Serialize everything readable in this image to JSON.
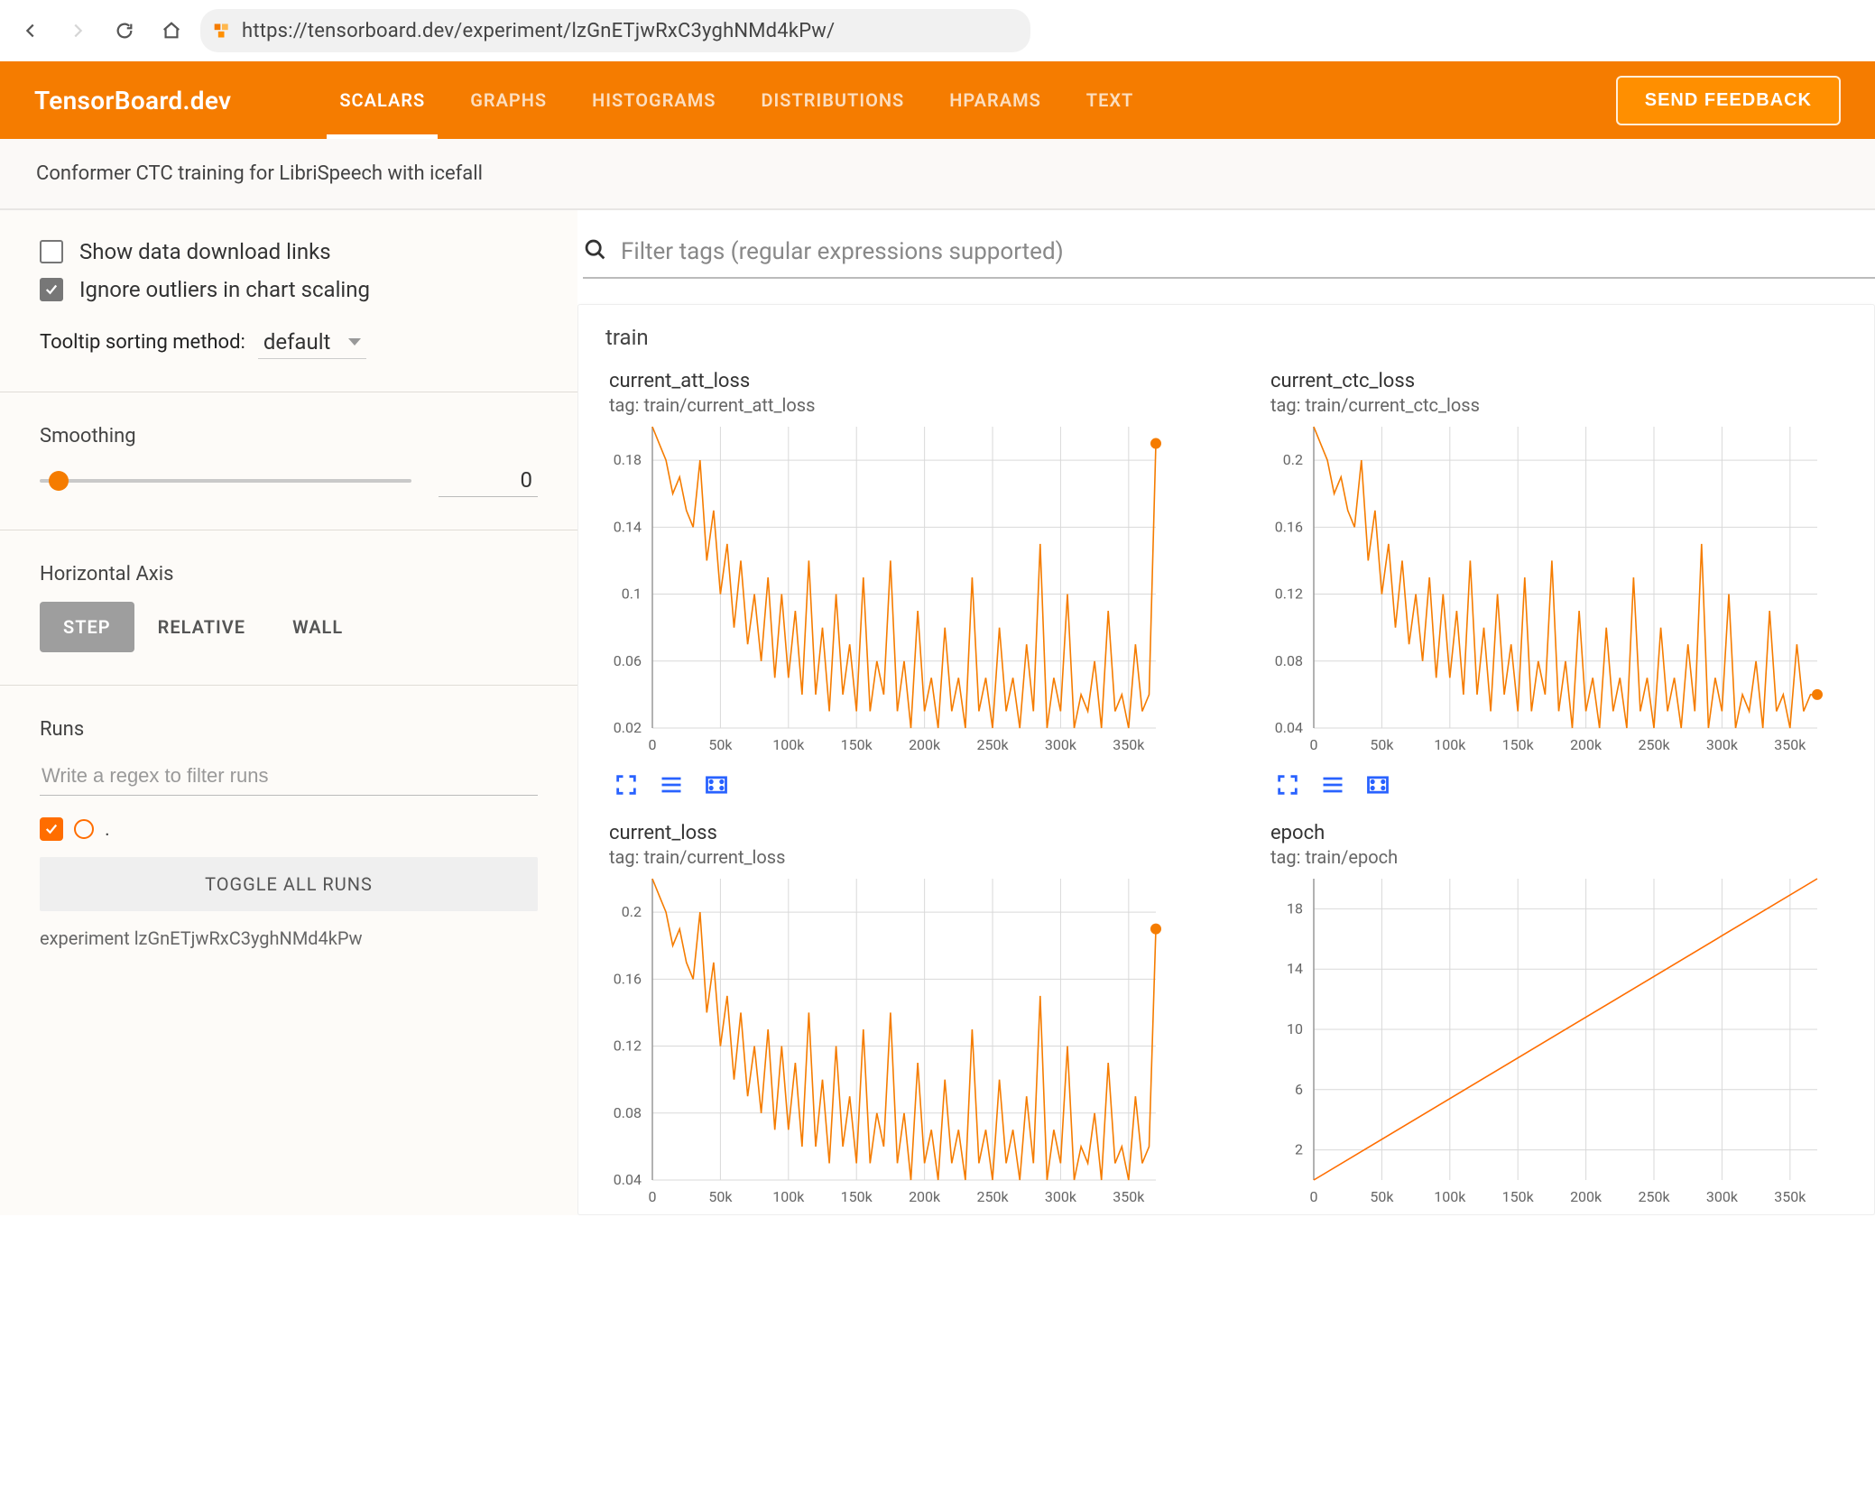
{
  "browser": {
    "url": "https://tensorboard.dev/experiment/lzGnETjwRxC3yghNMd4kPw/"
  },
  "header": {
    "logo": "TensorBoard.dev",
    "tabs": [
      "SCALARS",
      "GRAPHS",
      "HISTOGRAMS",
      "DISTRIBUTIONS",
      "HPARAMS",
      "TEXT"
    ],
    "active_tab": "SCALARS",
    "feedback_label": "SEND FEEDBACK"
  },
  "subheader": "Conformer CTC training for LibriSpeech with icefall",
  "sidebar": {
    "show_download_links": {
      "label": "Show data download links",
      "checked": false
    },
    "ignore_outliers": {
      "label": "Ignore outliers in chart scaling",
      "checked": true
    },
    "tooltip_sort": {
      "label": "Tooltip sorting method:",
      "value": "default"
    },
    "smoothing": {
      "label": "Smoothing",
      "value": "0",
      "position_pct": 5
    },
    "horizontal_axis": {
      "label": "Horizontal Axis",
      "options": [
        "STEP",
        "RELATIVE",
        "WALL"
      ],
      "active": "STEP"
    },
    "runs": {
      "label": "Runs",
      "filter_placeholder": "Write a regex to filter runs",
      "toggle_all_label": "TOGGLE ALL RUNS",
      "run_name": "."
    },
    "experiment_line": "experiment lzGnETjwRxC3yghNMd4kPw"
  },
  "content": {
    "filter_placeholder": "Filter tags (regular expressions supported)",
    "group_title": "train"
  },
  "chart_data": [
    {
      "id": "current_att_loss",
      "title": "current_att_loss",
      "tag": "tag: train/current_att_loss",
      "type": "line",
      "xlabel": "",
      "ylabel": "",
      "xlim": [
        0,
        370000
      ],
      "ylim": [
        0.02,
        0.2
      ],
      "x_ticks": [
        0,
        50000,
        100000,
        150000,
        200000,
        250000,
        300000,
        350000
      ],
      "x_tick_labels": [
        "0",
        "50k",
        "100k",
        "150k",
        "200k",
        "250k",
        "300k",
        "350k"
      ],
      "y_ticks": [
        0.02,
        0.06,
        0.1,
        0.14,
        0.18
      ],
      "series": [
        {
          "name": ".",
          "color": "#f57c00",
          "x": [
            0,
            5000,
            10000,
            15000,
            20000,
            25000,
            30000,
            35000,
            40000,
            45000,
            50000,
            55000,
            60000,
            65000,
            70000,
            75000,
            80000,
            85000,
            90000,
            95000,
            100000,
            105000,
            110000,
            115000,
            120000,
            125000,
            130000,
            135000,
            140000,
            145000,
            150000,
            155000,
            160000,
            165000,
            170000,
            175000,
            180000,
            185000,
            190000,
            195000,
            200000,
            205000,
            210000,
            215000,
            220000,
            225000,
            230000,
            235000,
            240000,
            245000,
            250000,
            255000,
            260000,
            265000,
            270000,
            275000,
            280000,
            285000,
            290000,
            295000,
            300000,
            305000,
            310000,
            315000,
            320000,
            325000,
            330000,
            335000,
            340000,
            345000,
            350000,
            355000,
            360000,
            365000,
            370000
          ],
          "values": [
            0.2,
            0.19,
            0.18,
            0.16,
            0.17,
            0.15,
            0.14,
            0.18,
            0.12,
            0.15,
            0.1,
            0.13,
            0.08,
            0.12,
            0.07,
            0.1,
            0.06,
            0.11,
            0.05,
            0.1,
            0.05,
            0.09,
            0.04,
            0.12,
            0.04,
            0.08,
            0.03,
            0.1,
            0.04,
            0.07,
            0.03,
            0.11,
            0.03,
            0.06,
            0.04,
            0.12,
            0.03,
            0.06,
            0.02,
            0.09,
            0.03,
            0.05,
            0.02,
            0.08,
            0.03,
            0.05,
            0.02,
            0.11,
            0.03,
            0.05,
            0.02,
            0.08,
            0.03,
            0.05,
            0.02,
            0.07,
            0.03,
            0.13,
            0.02,
            0.05,
            0.03,
            0.1,
            0.02,
            0.04,
            0.03,
            0.06,
            0.02,
            0.09,
            0.03,
            0.04,
            0.02,
            0.07,
            0.03,
            0.04,
            0.19
          ]
        }
      ],
      "end_marker": true
    },
    {
      "id": "current_ctc_loss",
      "title": "current_ctc_loss",
      "tag": "tag: train/current_ctc_loss",
      "type": "line",
      "xlabel": "",
      "ylabel": "",
      "xlim": [
        0,
        370000
      ],
      "ylim": [
        0.04,
        0.22
      ],
      "x_ticks": [
        0,
        50000,
        100000,
        150000,
        200000,
        250000,
        300000,
        350000
      ],
      "x_tick_labels": [
        "0",
        "50k",
        "100k",
        "150k",
        "200k",
        "250k",
        "300k",
        "350k"
      ],
      "y_ticks": [
        0.04,
        0.08,
        0.12,
        0.16,
        0.2
      ],
      "series": [
        {
          "name": ".",
          "color": "#f57c00",
          "x": [
            0,
            5000,
            10000,
            15000,
            20000,
            25000,
            30000,
            35000,
            40000,
            45000,
            50000,
            55000,
            60000,
            65000,
            70000,
            75000,
            80000,
            85000,
            90000,
            95000,
            100000,
            105000,
            110000,
            115000,
            120000,
            125000,
            130000,
            135000,
            140000,
            145000,
            150000,
            155000,
            160000,
            165000,
            170000,
            175000,
            180000,
            185000,
            190000,
            195000,
            200000,
            205000,
            210000,
            215000,
            220000,
            225000,
            230000,
            235000,
            240000,
            245000,
            250000,
            255000,
            260000,
            265000,
            270000,
            275000,
            280000,
            285000,
            290000,
            295000,
            300000,
            305000,
            310000,
            315000,
            320000,
            325000,
            330000,
            335000,
            340000,
            345000,
            350000,
            355000,
            360000,
            365000,
            370000
          ],
          "values": [
            0.22,
            0.21,
            0.2,
            0.18,
            0.19,
            0.17,
            0.16,
            0.2,
            0.14,
            0.17,
            0.12,
            0.15,
            0.1,
            0.14,
            0.09,
            0.12,
            0.08,
            0.13,
            0.07,
            0.12,
            0.07,
            0.11,
            0.06,
            0.14,
            0.06,
            0.1,
            0.05,
            0.12,
            0.06,
            0.09,
            0.05,
            0.13,
            0.05,
            0.08,
            0.06,
            0.14,
            0.05,
            0.08,
            0.04,
            0.11,
            0.05,
            0.07,
            0.04,
            0.1,
            0.05,
            0.07,
            0.04,
            0.13,
            0.05,
            0.07,
            0.04,
            0.1,
            0.05,
            0.07,
            0.04,
            0.09,
            0.05,
            0.15,
            0.04,
            0.07,
            0.05,
            0.12,
            0.04,
            0.06,
            0.05,
            0.08,
            0.04,
            0.11,
            0.05,
            0.06,
            0.04,
            0.09,
            0.05,
            0.06,
            0.06
          ]
        }
      ],
      "end_marker": true
    },
    {
      "id": "current_loss",
      "title": "current_loss",
      "tag": "tag: train/current_loss",
      "type": "line",
      "xlabel": "",
      "ylabel": "",
      "xlim": [
        0,
        370000
      ],
      "ylim": [
        0.04,
        0.22
      ],
      "x_ticks": [
        0,
        50000,
        100000,
        150000,
        200000,
        250000,
        300000,
        350000
      ],
      "x_tick_labels": [
        "0",
        "50k",
        "100k",
        "150k",
        "200k",
        "250k",
        "300k",
        "350k"
      ],
      "y_ticks": [
        0.04,
        0.08,
        0.12,
        0.16,
        0.2
      ],
      "series": [
        {
          "name": ".",
          "color": "#f57c00",
          "x": [
            0,
            5000,
            10000,
            15000,
            20000,
            25000,
            30000,
            35000,
            40000,
            45000,
            50000,
            55000,
            60000,
            65000,
            70000,
            75000,
            80000,
            85000,
            90000,
            95000,
            100000,
            105000,
            110000,
            115000,
            120000,
            125000,
            130000,
            135000,
            140000,
            145000,
            150000,
            155000,
            160000,
            165000,
            170000,
            175000,
            180000,
            185000,
            190000,
            195000,
            200000,
            205000,
            210000,
            215000,
            220000,
            225000,
            230000,
            235000,
            240000,
            245000,
            250000,
            255000,
            260000,
            265000,
            270000,
            275000,
            280000,
            285000,
            290000,
            295000,
            300000,
            305000,
            310000,
            315000,
            320000,
            325000,
            330000,
            335000,
            340000,
            345000,
            350000,
            355000,
            360000,
            365000,
            370000
          ],
          "values": [
            0.22,
            0.21,
            0.2,
            0.18,
            0.19,
            0.17,
            0.16,
            0.2,
            0.14,
            0.17,
            0.12,
            0.15,
            0.1,
            0.14,
            0.09,
            0.12,
            0.08,
            0.13,
            0.07,
            0.12,
            0.07,
            0.11,
            0.06,
            0.14,
            0.06,
            0.1,
            0.05,
            0.12,
            0.06,
            0.09,
            0.05,
            0.13,
            0.05,
            0.08,
            0.06,
            0.14,
            0.05,
            0.08,
            0.04,
            0.11,
            0.05,
            0.07,
            0.04,
            0.1,
            0.05,
            0.07,
            0.04,
            0.13,
            0.05,
            0.07,
            0.04,
            0.1,
            0.05,
            0.07,
            0.04,
            0.09,
            0.05,
            0.15,
            0.04,
            0.07,
            0.05,
            0.12,
            0.04,
            0.06,
            0.05,
            0.08,
            0.04,
            0.11,
            0.05,
            0.06,
            0.04,
            0.09,
            0.05,
            0.06,
            0.19
          ]
        }
      ],
      "end_marker": true
    },
    {
      "id": "epoch",
      "title": "epoch",
      "tag": "tag: train/epoch",
      "type": "line",
      "xlabel": "",
      "ylabel": "",
      "xlim": [
        0,
        370000
      ],
      "ylim": [
        0,
        20
      ],
      "x_ticks": [
        0,
        50000,
        100000,
        150000,
        200000,
        250000,
        300000,
        350000
      ],
      "x_tick_labels": [
        "0",
        "50k",
        "100k",
        "150k",
        "200k",
        "250k",
        "300k",
        "350k"
      ],
      "y_ticks": [
        2,
        6,
        10,
        14,
        18
      ],
      "series": [
        {
          "name": ".",
          "color": "#ff6d00",
          "x": [
            0,
            370000
          ],
          "values": [
            0,
            20
          ]
        }
      ],
      "end_marker": false
    }
  ]
}
